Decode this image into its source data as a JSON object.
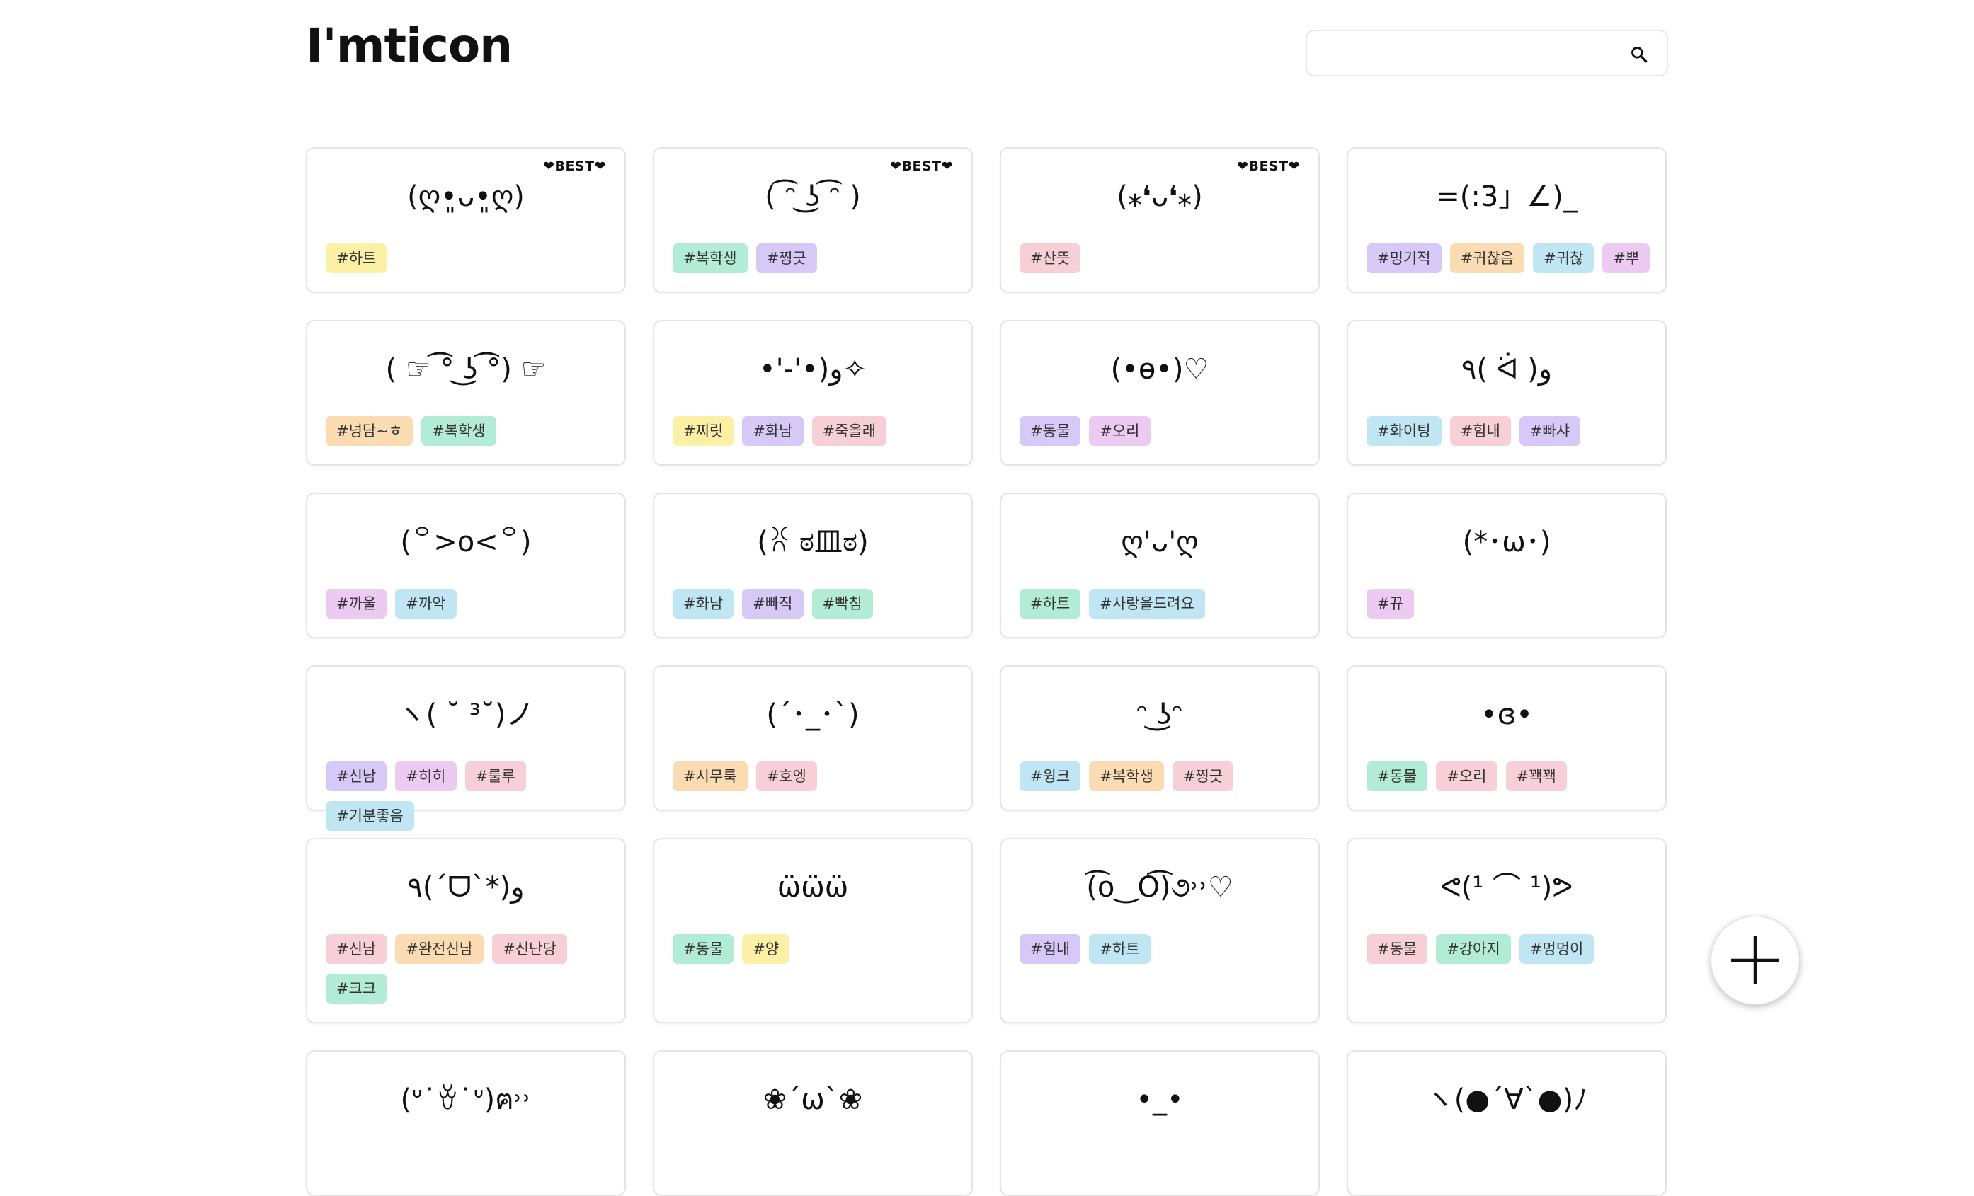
{
  "app": {
    "title": "I'mticon"
  },
  "search": {
    "placeholder": "",
    "value": ""
  },
  "best_label": "❤BEST❤",
  "colors": {
    "yellow": "#fcefa6",
    "green": "#b3ecd6",
    "purple": "#d6c8f7",
    "pink": "#f7cfd6",
    "orange": "#fbdcb2",
    "blue": "#bfe6f2",
    "violet": "#eccaf2"
  },
  "cards": [
    {
      "emoticon": "(ღ•͈ᴗ•͈ღ)",
      "best": true,
      "tags": [
        {
          "text": "#하트",
          "color": "yellow"
        }
      ]
    },
    {
      "emoticon": "( ͡ᵔ ͜ʖ ͡ᵔ )",
      "best": true,
      "tags": [
        {
          "text": "#복학생",
          "color": "green"
        },
        {
          "text": "#찡긋",
          "color": "purple"
        }
      ]
    },
    {
      "emoticon": "(⁎❛ᴗ❛⁎)",
      "best": true,
      "tags": [
        {
          "text": "#산뜻",
          "color": "pink"
        }
      ]
    },
    {
      "emoticon": "=(:3」∠)_",
      "best": false,
      "tags": [
        {
          "text": "#밍기적",
          "color": "purple"
        },
        {
          "text": "#귀찮음",
          "color": "orange"
        },
        {
          "text": "#귀찮",
          "color": "blue"
        },
        {
          "text": "#뿌",
          "color": "violet"
        }
      ]
    },
    {
      "emoticon": "( ☞ ͡° ͜ʖ ͡°) ☞",
      "best": false,
      "tags": [
        {
          "text": "#넝담~ㅎ",
          "color": "orange"
        },
        {
          "text": "#복학생",
          "color": "green"
        }
      ]
    },
    {
      "emoticon": "•'-'•)و✧",
      "best": false,
      "tags": [
        {
          "text": "#찌릿",
          "color": "yellow"
        },
        {
          "text": "#화남",
          "color": "purple"
        },
        {
          "text": "#죽을래",
          "color": "pink"
        }
      ]
    },
    {
      "emoticon": "(•ɵ•)♡",
      "best": false,
      "tags": [
        {
          "text": "#동물",
          "color": "purple"
        },
        {
          "text": "#오리",
          "color": "violet"
        }
      ]
    },
    {
      "emoticon": "٩( ᐛ )و",
      "best": false,
      "tags": [
        {
          "text": "#화이팅",
          "color": "blue"
        },
        {
          "text": "#힘내",
          "color": "pink"
        },
        {
          "text": "#빠샤",
          "color": "purple"
        }
      ]
    },
    {
      "emoticon": "(꒪>o<꒪)",
      "best": false,
      "tags": [
        {
          "text": "#까울",
          "color": "violet"
        },
        {
          "text": "#까악",
          "color": "blue"
        }
      ]
    },
    {
      "emoticon": "(ꐦ ಠ皿ಠ)",
      "best": false,
      "tags": [
        {
          "text": "#화남",
          "color": "blue"
        },
        {
          "text": "#빠직",
          "color": "purple"
        },
        {
          "text": "#빡침",
          "color": "green"
        }
      ]
    },
    {
      "emoticon": "ღ'ᴗ'ღ",
      "best": false,
      "tags": [
        {
          "text": "#하트",
          "color": "green"
        },
        {
          "text": "#사랑을드려요",
          "color": "blue"
        }
      ]
    },
    {
      "emoticon": "(*･ω･)",
      "best": false,
      "tags": [
        {
          "text": "#뀨",
          "color": "violet"
        }
      ]
    },
    {
      "emoticon": "ヽ( ˘ ³˘)ノ",
      "best": false,
      "tags": [
        {
          "text": "#신남",
          "color": "purple"
        },
        {
          "text": "#히히",
          "color": "violet"
        },
        {
          "text": "#룰루",
          "color": "pink"
        },
        {
          "text": "#기분좋음",
          "color": "blue"
        }
      ]
    },
    {
      "emoticon": "(´･_･`)",
      "best": false,
      "tags": [
        {
          "text": "#시무룩",
          "color": "orange"
        },
        {
          "text": "#호엥",
          "color": "pink"
        }
      ]
    },
    {
      "emoticon": "ᵔ ͜ʖᵔ",
      "best": false,
      "tags": [
        {
          "text": "#윙크",
          "color": "blue"
        },
        {
          "text": "#복학생",
          "color": "orange"
        },
        {
          "text": "#찡긋",
          "color": "pink"
        }
      ]
    },
    {
      "emoticon": "•ɞ•",
      "best": false,
      "tags": [
        {
          "text": "#동물",
          "color": "green"
        },
        {
          "text": "#오리",
          "color": "pink"
        },
        {
          "text": "#꽥꽥",
          "color": "pink"
        }
      ]
    },
    {
      "emoticon": "٩(´ᗜ`*)و",
      "best": false,
      "tags": [
        {
          "text": "#신남",
          "color": "pink"
        },
        {
          "text": "#완전신남",
          "color": "orange"
        },
        {
          "text": "#신난당",
          "color": "pink"
        },
        {
          "text": "#크크",
          "color": "green"
        }
      ]
    },
    {
      "emoticon": "ω̈ω̈ω̈",
      "best": false,
      "tags": [
        {
          "text": "#동물",
          "color": "green"
        },
        {
          "text": "#양",
          "color": "yellow"
        }
      ]
    },
    {
      "emoticon": "(͡o‿O͡)૭˒˒♡",
      "best": false,
      "tags": [
        {
          "text": "#힘내",
          "color": "purple"
        },
        {
          "text": "#하트",
          "color": "blue"
        }
      ]
    },
    {
      "emoticon": "ᕙ(¹ ⌒ ¹)ᕗ",
      "best": false,
      "tags": [
        {
          "text": "#동물",
          "color": "pink"
        },
        {
          "text": "#강아지",
          "color": "green"
        },
        {
          "text": "#멍멍이",
          "color": "blue"
        }
      ]
    },
    {
      "emoticon": "(ᐡ˙ꈊ˙ᐡ)ฅ˒˒",
      "best": false,
      "tags": []
    },
    {
      "emoticon": "❀´ω`❀",
      "best": false,
      "tags": []
    },
    {
      "emoticon": "•_•",
      "best": false,
      "tags": []
    },
    {
      "emoticon": "ヽ(●´∀`●)ﾉ",
      "best": false,
      "tags": []
    }
  ]
}
